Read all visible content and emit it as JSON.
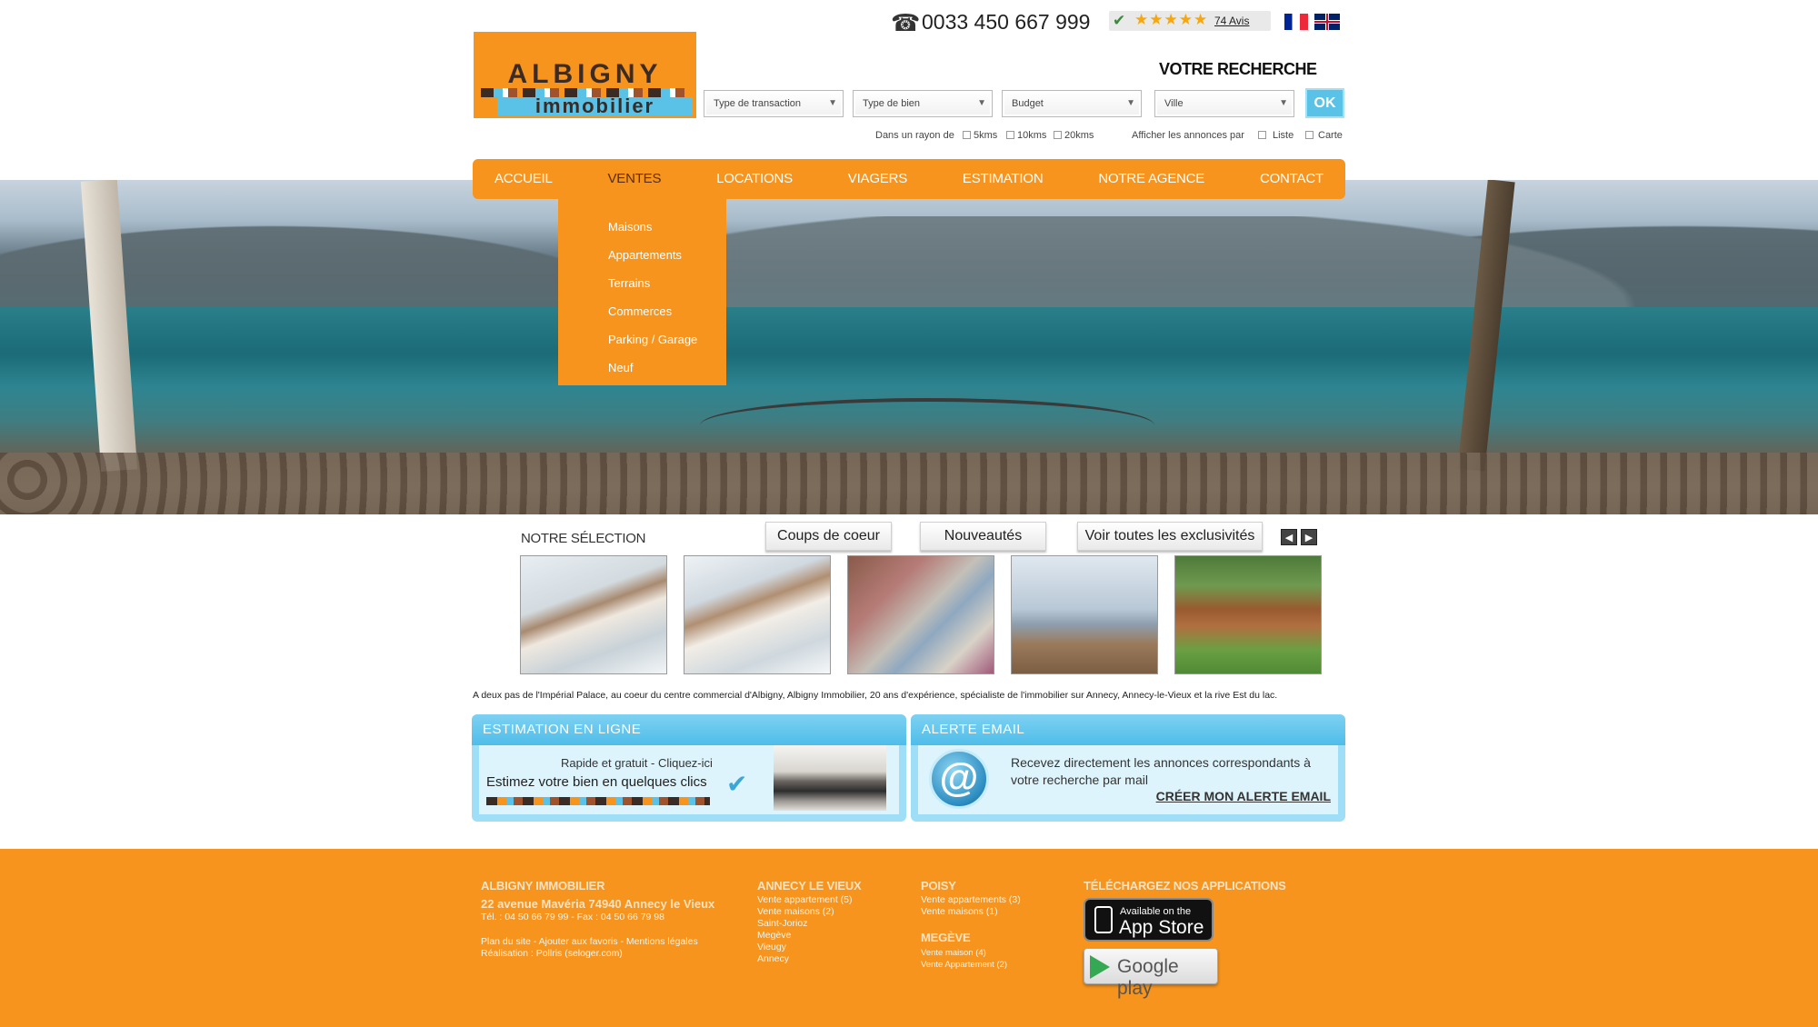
{
  "header": {
    "phone": "0033 450 667 999",
    "reviews_count": "74 Avis",
    "reviews_stars": "★★★★★",
    "logo_brand": "ALBIGNY",
    "logo_sub": "immobilier"
  },
  "search": {
    "title": "VOTRE RECHERCHE",
    "transaction": "Type de transaction",
    "bien": "Type de bien",
    "budget": "Budget",
    "ville": "Ville",
    "ok": "OK",
    "radius_label": "Dans un rayon de",
    "radius_5": "5kms",
    "radius_10": "10kms",
    "radius_20": "20kms",
    "display_label": "Afficher les annonces par",
    "display_liste": "Liste",
    "display_carte": "Carte"
  },
  "nav": {
    "items": [
      "ACCUEIL",
      "VENTES",
      "LOCATIONS",
      "VIAGERS",
      "ESTIMATION",
      "NOTRE AGENCE",
      "CONTACT"
    ],
    "active": "VENTES",
    "dropdown": [
      "Maisons",
      "Appartements",
      "Terrains",
      "Commerces",
      "Parking / Garage",
      "Neuf"
    ]
  },
  "selection": {
    "title": "NOTRE SÉLECTION",
    "tab_coups": "Coups de coeur",
    "tab_nouveautes": "Nouveautés",
    "tab_exclu": "Voir toutes les exclusivités"
  },
  "intro": "A deux pas de l'Impérial Palace, au coeur du centre commercial d'Albigny, Albigny Immobilier, 20 ans d'expérience, spécialiste de l'immobilier sur Annecy, Annecy-le-Vieux et la rive Est du lac.",
  "estimation": {
    "title": "ESTIMATION EN LIGNE",
    "subtitle": "Rapide et gratuit - Cliquez-ici",
    "main": "Estimez votre bien en quelques clics"
  },
  "alerte": {
    "title": "ALERTE EMAIL",
    "text": "Recevez directement les annonces correspondants à votre recherche par mail",
    "link": "CRÉER MON ALERTE EMAIL"
  },
  "footer": {
    "company": "ALBIGNY IMMOBILIER",
    "address": "22 avenue Mavéria 74940 Annecy le Vieux",
    "tel": "Tél. : 04 50 66 79 99 - Fax : 04 50 66 79 98",
    "links": "Plan du site - Ajouter aux favoris - Mentions légales",
    "realisation": "Réalisation : Pollris (seloger.com)",
    "annecy_title": "ANNECY LE VIEUX",
    "annecy_list": [
      "Vente appartement (5)",
      "Vente maisons (2)",
      "Saint-Jorioz",
      "Megève",
      "Vieugy",
      "Annecy"
    ],
    "poisy_title": "POISY",
    "poisy_list": [
      "Vente appartements (3)",
      "Vente maisons (1)"
    ],
    "megeve_title": "MEGÈVE",
    "megeve_list": [
      "Vente maison (4)",
      "Vente Appartement (2)"
    ],
    "apps_title": "TÉLÉCHARGEZ NOS APPLICATIONS",
    "appstore_small": "Available on the",
    "appstore_big": "App Store",
    "googleplay": "Google play"
  },
  "colors": {
    "orange": "#f7941d",
    "blue": "#5bc2e7",
    "brown": "#3b2b25"
  }
}
